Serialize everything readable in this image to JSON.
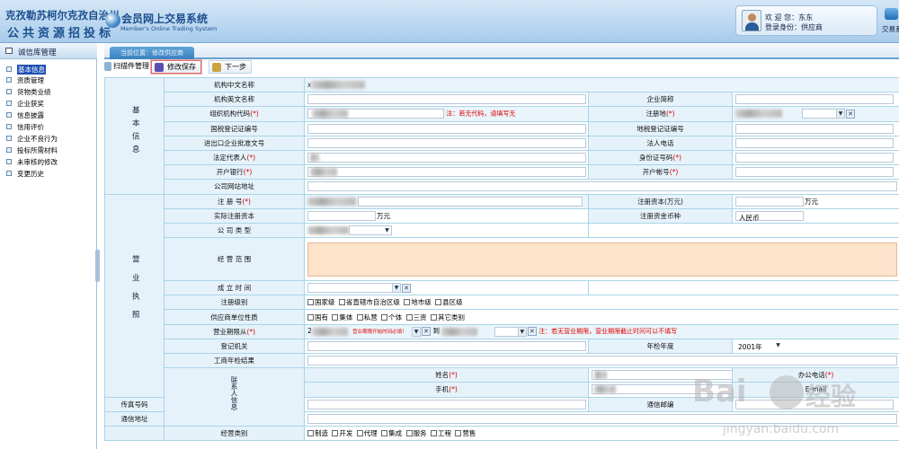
{
  "header": {
    "logo_line1": "克孜勒苏柯尔克孜自治州",
    "logo_line2": "公共资源招投标",
    "system_name": "会员网上交易系统",
    "system_name_en": "Member's Online Trading System",
    "welcome": "欢 迎 您：东东",
    "identity": "登录身份：供应商",
    "exit_label": "交易系"
  },
  "sidebar": {
    "title": "诚信库管理",
    "items": [
      {
        "label": "基本信息",
        "active": true
      },
      {
        "label": "资质管理",
        "active": false
      },
      {
        "label": "货物类业绩",
        "active": false
      },
      {
        "label": "企业获奖",
        "active": false
      },
      {
        "label": "信息披露",
        "active": false
      },
      {
        "label": "信用评价",
        "active": false
      },
      {
        "label": "企业不良行为",
        "active": false
      },
      {
        "label": "投标所需材料",
        "active": false
      },
      {
        "label": "未审核的修改",
        "active": false
      },
      {
        "label": "变更历史",
        "active": false
      }
    ]
  },
  "tab": {
    "current": "当前位置：修改供应商"
  },
  "toolbar": {
    "scan": "扫描件管理",
    "save": "修改保存",
    "next": "下一步"
  },
  "sections": {
    "basic": "基本信息",
    "business": "营业执照",
    "contact": "联系人信息"
  },
  "form": {
    "org_cn_name": "机构中文名称",
    "org_cn_value": "X",
    "org_en_name": "机构英文名称",
    "short_name": "企业简称",
    "org_code": "组织机构代码",
    "org_code_note": "注：若无代码，请填写无",
    "reg_place": "注册地",
    "nat_tax": "国税登记证编号",
    "local_tax": "地税登记证编号",
    "import_export": "进出口企业批准文号",
    "legal_phone": "法人电话",
    "legal_rep": "法定代表人",
    "id_number": "身份证号码",
    "bank": "开户银行",
    "account": "开户帐号",
    "website": "公司网站地址",
    "reg_number": "注 册 号",
    "reg_capital": "注册资本(万元)",
    "capital_unit": "万元",
    "paid_capital": "实际注册资本",
    "currency": "注册资金币种",
    "currency_value": "人民币",
    "company_type": "公 司 类 型",
    "business_scope": "经 营 范 围",
    "established": "成 立 时 间",
    "reg_level": "注册级别",
    "reg_level_options": [
      "国家级",
      "省直辖市自治区级",
      "地市级",
      "县区级"
    ],
    "supplier_nature": "供应商单位性质",
    "supplier_nature_options": [
      "国有",
      "集体",
      "私营",
      "个体",
      "三资",
      "其它类别"
    ],
    "business_period": "营业期限从",
    "period_start_prefix": "2",
    "period_start_note": "营业期限开始时间必填！",
    "period_to": "到",
    "period_note": "注：若无营业期限，营业期限截止时间可以不填写",
    "reg_authority": "登记机关",
    "annual_year": "年检年度",
    "annual_year_value": "2001年",
    "annual_result": "工商年检结果",
    "contact_name": "姓名",
    "office_phone": "办公电话",
    "mobile": "手机",
    "email": "E-mail",
    "fax": "传真号码",
    "postcode": "通信邮编",
    "address": "通信地址",
    "business_category": "经营类别",
    "business_category_options": [
      "制造",
      "开发",
      "代理",
      "集成",
      "服务",
      "工程",
      "营售"
    ]
  },
  "watermark": {
    "text1": "Bai",
    "text2": "经验",
    "url": "jingyan.baidu.com"
  },
  "colors": {
    "required": "#d40000",
    "header": "#b6d4ef",
    "label_bg": "#e6f2fa",
    "accent": "#3a80c0"
  }
}
